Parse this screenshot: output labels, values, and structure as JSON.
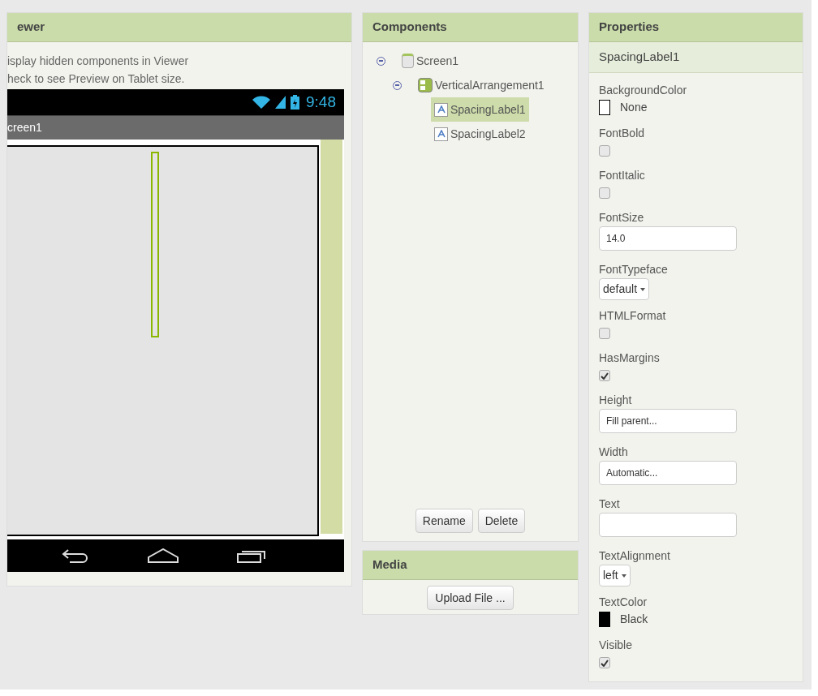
{
  "viewer": {
    "title": "ewer",
    "options": [
      {
        "label": "isplay hidden components in Viewer"
      },
      {
        "label": "heck to see Preview on Tablet size."
      }
    ],
    "phone": {
      "time": "9:48",
      "screen_title": "creen1"
    }
  },
  "components": {
    "title": "Components",
    "tree": [
      {
        "label": "Screen1",
        "kind": "screen",
        "expanded": true,
        "selected": false,
        "children": [
          {
            "label": "VerticalArrangement1",
            "kind": "arrangement",
            "expanded": true,
            "selected": false,
            "children": [
              {
                "label": "SpacingLabel1",
                "kind": "label",
                "selected": true
              },
              {
                "label": "SpacingLabel2",
                "kind": "label",
                "selected": false
              }
            ]
          }
        ]
      }
    ],
    "buttons": [
      "Rename",
      "Delete"
    ]
  },
  "media": {
    "title": "Media",
    "button": "Upload File ..."
  },
  "properties": {
    "title": "Properties",
    "component": "SpacingLabel1",
    "items": [
      {
        "label": "BackgroundColor",
        "kind": "color",
        "value": "None",
        "color": "#ffffff"
      },
      {
        "label": "FontBold",
        "kind": "checkbox",
        "checked": false
      },
      {
        "label": "FontItalic",
        "kind": "checkbox",
        "checked": false
      },
      {
        "label": "FontSize",
        "kind": "textbox",
        "value": "14.0"
      },
      {
        "label": "FontTypeface",
        "kind": "dropdown",
        "value": "default"
      },
      {
        "label": "HTMLFormat",
        "kind": "checkbox",
        "checked": false
      },
      {
        "label": "HasMargins",
        "kind": "checkbox",
        "checked": true
      },
      {
        "label": "Height",
        "kind": "textbox",
        "value": "Fill parent..."
      },
      {
        "label": "Width",
        "kind": "textbox",
        "value": "Automatic..."
      },
      {
        "label": "Text",
        "kind": "textbox"
      },
      {
        "label": "TextAlignment",
        "kind": "dropdown",
        "value": "left"
      },
      {
        "label": "TextColor",
        "kind": "color",
        "value": "Black",
        "color": "#000000"
      },
      {
        "label": "Visible",
        "kind": "checkbox",
        "checked": true
      }
    ]
  }
}
